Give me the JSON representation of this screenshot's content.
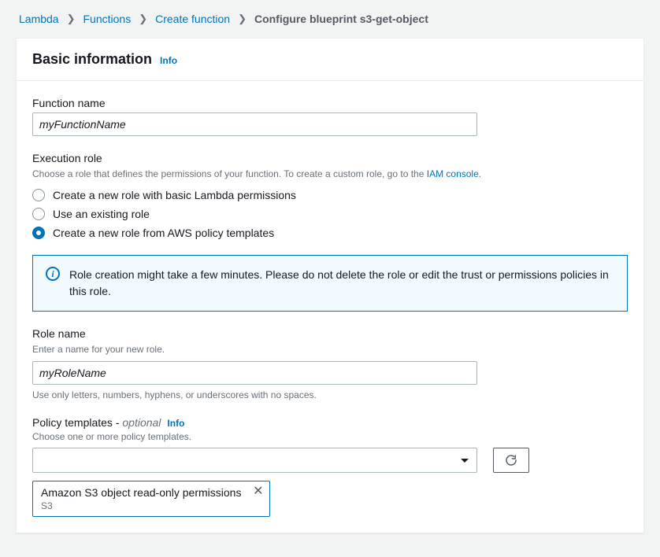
{
  "breadcrumbs": {
    "items": [
      "Lambda",
      "Functions",
      "Create function"
    ],
    "current": "Configure blueprint s3-get-object"
  },
  "panel": {
    "title": "Basic information",
    "info": "Info"
  },
  "functionName": {
    "label": "Function name",
    "value": "myFunctionName"
  },
  "executionRole": {
    "label": "Execution role",
    "description_pre": "Choose a role that defines the permissions of your function. To create a custom role, go to the ",
    "link_text": "IAM console",
    "description_post": ".",
    "options": [
      "Create a new role with basic Lambda permissions",
      "Use an existing role",
      "Create a new role from AWS policy templates"
    ],
    "selectedIndex": 2
  },
  "alert": {
    "text": "Role creation might take a few minutes. Please do not delete the role or edit the trust or permissions policies in this role."
  },
  "roleName": {
    "label": "Role name",
    "description": "Enter a name for your new role.",
    "value": "myRoleName",
    "constraint": "Use only letters, numbers, hyphens, or underscores with no spaces."
  },
  "policyTemplates": {
    "label_main": "Policy templates - ",
    "label_optional": "optional",
    "info": "Info",
    "description": "Choose one or more policy templates.",
    "selectedToken": {
      "title": "Amazon S3 object read-only permissions",
      "subtitle": "S3"
    }
  }
}
